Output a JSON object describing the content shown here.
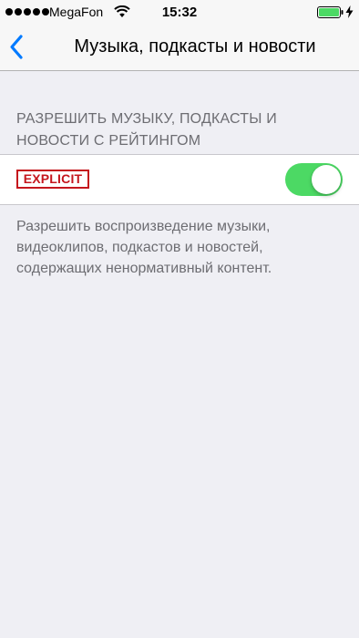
{
  "status_bar": {
    "carrier": "MegaFon",
    "time": "15:32"
  },
  "nav": {
    "title": "Музыка, подкасты и новости"
  },
  "section": {
    "header_lines": [
      "РАЗРЕШИТЬ МУЗЫКУ, ПОДКАСТЫ И",
      "НОВОСТИ С РЕЙТИНГОМ"
    ],
    "cell": {
      "badge_label": "EXPLICIT",
      "toggle_on": true
    },
    "footer_lines": [
      "Разрешить воспроизведение музыки,",
      "видеоклипов, подкастов и новостей,",
      "содержащих ненормативный контент."
    ]
  },
  "colors": {
    "background": "#efeff4",
    "toggle_on": "#4cd964",
    "accent": "#007aff",
    "badge": "#c5161d",
    "battery": "#4cd964"
  }
}
